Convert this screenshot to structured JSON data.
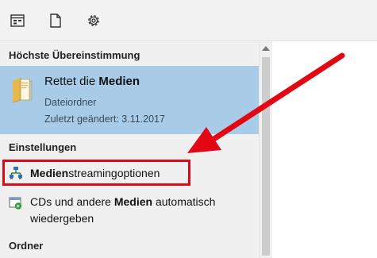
{
  "toolbar": {
    "icons": [
      "apps-icon",
      "document-icon",
      "settings-gear-icon"
    ]
  },
  "sections": {
    "best_match": "Höchste Übereinstimmung",
    "settings": "Einstellungen",
    "folders": "Ordner"
  },
  "best_match_item": {
    "title_prefix": "Rettet die ",
    "title_bold": "Medien",
    "type": "Dateiordner",
    "modified": "Zuletzt geändert: 3.11.2017"
  },
  "settings_items": [
    {
      "bold": "Medien",
      "rest": "streamingoptionen",
      "icon": "network-computers-icon"
    },
    {
      "line1_prefix": "CDs und andere ",
      "line1_bold": "Medien",
      "line1_suffix": " automatisch",
      "line2": "wiedergeben",
      "icon": "autoplay-icon"
    }
  ],
  "colors": {
    "selection": "#a8cce8",
    "annotation": "#e30613",
    "panel_bg": "#f0f0f0"
  }
}
